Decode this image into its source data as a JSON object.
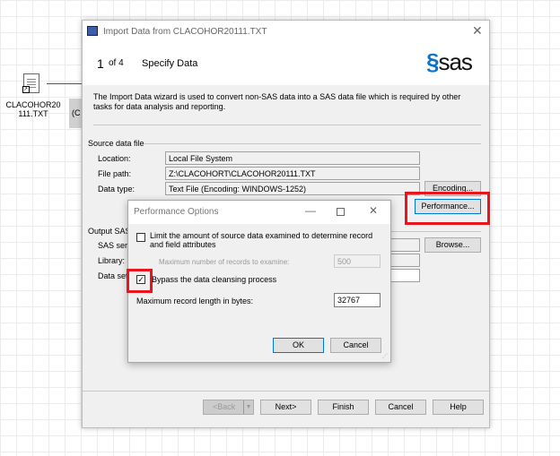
{
  "desktop": {
    "file_icon_label_1": "CLACOHOR20",
    "file_icon_label_2": "111.TXT",
    "partial_label": "(C"
  },
  "wizard": {
    "title": "Import Data from CLACOHOR20111.TXT",
    "step_number": "1",
    "step_of": "of 4",
    "step_title": "Specify Data",
    "logo": "sas",
    "description": "The Import Data wizard is used to convert non-SAS data into a SAS data file which is required by other tasks for data analysis and reporting.",
    "source": {
      "heading": "Source data file",
      "location_label": "Location:",
      "location_value": "Local File System",
      "path_label": "File path:",
      "path_value": "Z:\\CLACOHORT\\CLACOHOR20111.TXT",
      "type_label": "Data type:",
      "type_value": "Text File  (Encoding: WINDOWS-1252)",
      "encoding_button": "Encoding...",
      "performance_button": "Performance..."
    },
    "output": {
      "heading": "Output SAS",
      "server_label": "SAS serv",
      "library_label": "Library:",
      "dataset_label": "Data set",
      "browse_button": "Browse..."
    },
    "footer": {
      "back": "<Back",
      "next": "Next>",
      "finish": "Finish",
      "cancel": "Cancel",
      "help": "Help"
    }
  },
  "perf_dialog": {
    "title": "Performance Options",
    "limit_label": "Limit the amount of source data examined to determine record and field attributes",
    "limit_checked": false,
    "max_records_label": "Maximum number of records to examine:",
    "max_records_value": "500",
    "bypass_label": "Bypass the data cleansing process",
    "bypass_checked": true,
    "max_length_label": "Maximum record length in bytes:",
    "max_length_value": "32767",
    "ok": "OK",
    "cancel": "Cancel"
  },
  "colors": {
    "highlight": "#e8141e",
    "sas_blue": "#0a74c9",
    "focus_blue": "#0078d7"
  }
}
